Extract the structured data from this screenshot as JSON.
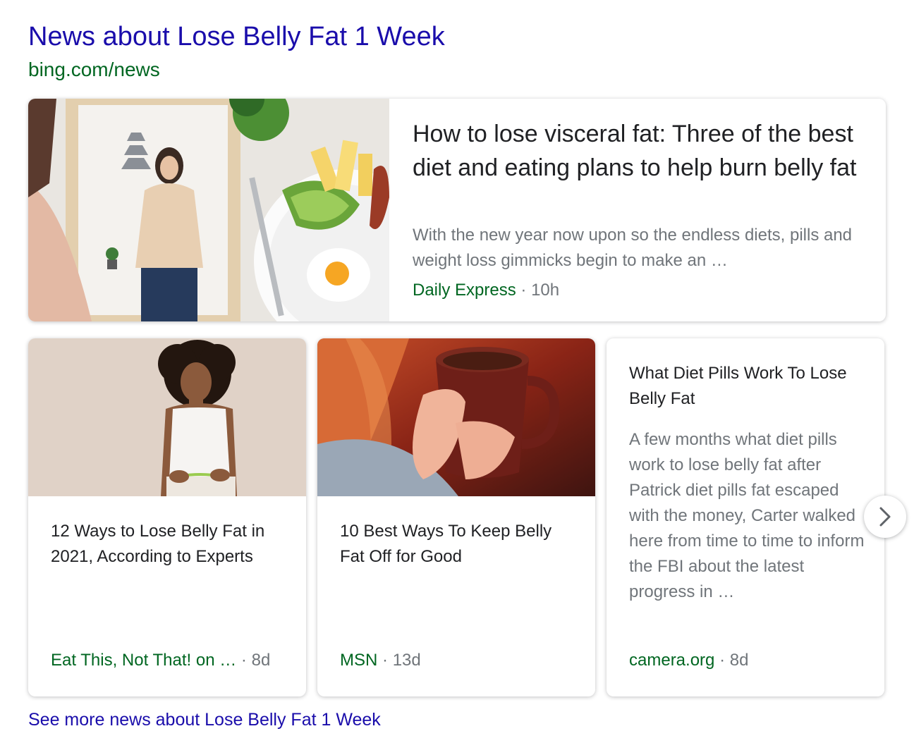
{
  "header": {
    "title": "News about Lose Belly Fat 1 Week",
    "source_url": "bing.com/news"
  },
  "featured": {
    "image": "woman-mirror-and-breakfast-plate",
    "headline": "How to lose visceral fat: Three of the best diet and eating plans to help burn belly fat",
    "snippet": "With the new year now upon so the endless diets, pills and weight loss gimmicks begin to make an …",
    "publisher": "Daily Express",
    "age": "10h"
  },
  "cards": [
    {
      "image": "woman-measuring-waist",
      "headline": "12 Ways to Lose Belly Fat in 2021, According to Experts",
      "publisher": "Eat This, Not That! on …",
      "age": "8d"
    },
    {
      "image": "hands-holding-tea-cup",
      "headline": "10 Best Ways To Keep Belly Fat Off for Good",
      "publisher": "MSN",
      "age": "13d"
    },
    {
      "headline": "What Diet Pills Work To Lose Belly Fat",
      "snippet": "A few months what diet pills work to lose belly fat after Patrick diet pills fat escaped with the money, Carter walked here from time to time to inform the FBI about the latest progress in …",
      "publisher": "camera.org",
      "age": "8d"
    }
  ],
  "separator": "·",
  "carousel": {
    "next_icon": "chevron-right-icon"
  },
  "footer": {
    "see_more": "See more news about Lose Belly Fat 1 Week"
  },
  "colors": {
    "link": "#1a0dab",
    "url_green": "#006621",
    "text": "#202124",
    "muted": "#70757a"
  }
}
